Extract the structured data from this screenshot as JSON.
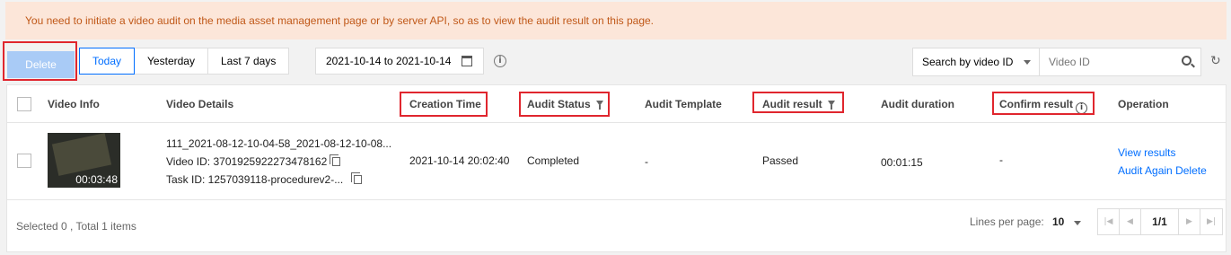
{
  "banner": {
    "text": "You need to initiate a video audit on the media asset management page or by server API, so as to view the audit result on this page."
  },
  "toolbar": {
    "delete_label": "Delete",
    "date_buttons": [
      "Today",
      "Yesterday",
      "Last 7 days"
    ],
    "date_range": "2021-10-14 to 2021-10-14",
    "search_type": "Search by video ID",
    "search_placeholder": "Video ID",
    "info_icon": "i",
    "refresh_icon": "↻"
  },
  "table": {
    "headers": {
      "video_info": "Video Info",
      "video_details": "Video Details",
      "creation_time": "Creation Time",
      "audit_status": "Audit Status",
      "audit_template": "Audit Template",
      "audit_result": "Audit result",
      "audit_duration": "Audit duration",
      "confirm_result": "Confirm result",
      "operation": "Operation"
    },
    "rows": [
      {
        "duration": "00:03:48",
        "title": "111_2021-08-12-10-04-58_2021-08-12-10-08...",
        "video_id": "Video ID: 3701925922273478162",
        "task_id": "Task ID: 1257039118-procedurev2-...",
        "creation_time": "2021-10-14 20:02:40",
        "audit_status": "Completed",
        "audit_template": "-",
        "audit_result": "Passed",
        "audit_duration": "00:01:15",
        "confirm_result": "-",
        "op_view": "View results",
        "op_again": "Audit Again",
        "op_delete": "Delete"
      }
    ]
  },
  "footer": {
    "selected": "Selected 0 , Total 1 items",
    "lines_per_page_label": "Lines per page:",
    "lines_per_page": "10",
    "page": "1/1"
  },
  "colors": {
    "banner_bg": "#fce6d9",
    "banner_text": "#c05818",
    "accent": "#006eff",
    "delete_disabled": "#a9cbf6",
    "highlight": "#e0262e"
  }
}
